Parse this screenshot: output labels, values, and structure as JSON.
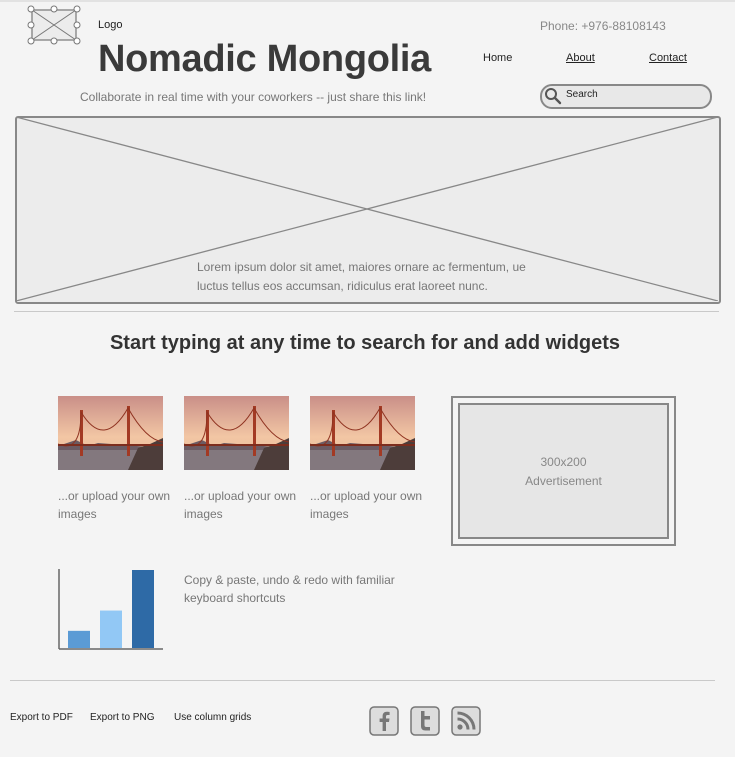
{
  "header": {
    "logo_label": "Logo",
    "site_title": "Nomadic Mongolia",
    "tagline": "Collaborate in real time with your coworkers -- just share this link!",
    "phone": "Phone: +976-88108143"
  },
  "nav": {
    "home": "Home",
    "about": "About",
    "contact": "Contact"
  },
  "search": {
    "placeholder": "Search"
  },
  "hero": {
    "text": "Lorem ipsum dolor sit amet, maiores ornare ac fermentum, ue luctus tellus eos accumsan, ridiculus erat laoreet nunc."
  },
  "section_title": "Start typing at any time to search for and add widgets",
  "gallery": {
    "captions": [
      "...or upload your own images",
      "...or upload your own images",
      "...or upload your own images"
    ]
  },
  "ad": {
    "size": "300x200",
    "label": "Advertisement"
  },
  "chart_widget": {
    "caption": "Copy & paste, undo & redo with familiar keyboard shortcuts",
    "bar_values": [
      0.22,
      0.48,
      1.0
    ],
    "bar_colors": [
      "#5b9bd5",
      "#92c8f5",
      "#2e6aa6"
    ]
  },
  "footer": {
    "export_pdf": "Export to PDF",
    "export_png": "Export to PNG",
    "column_grids": "Use column grids"
  },
  "social": {
    "icons": [
      "facebook-icon",
      "twitter-icon",
      "rss-icon"
    ]
  }
}
